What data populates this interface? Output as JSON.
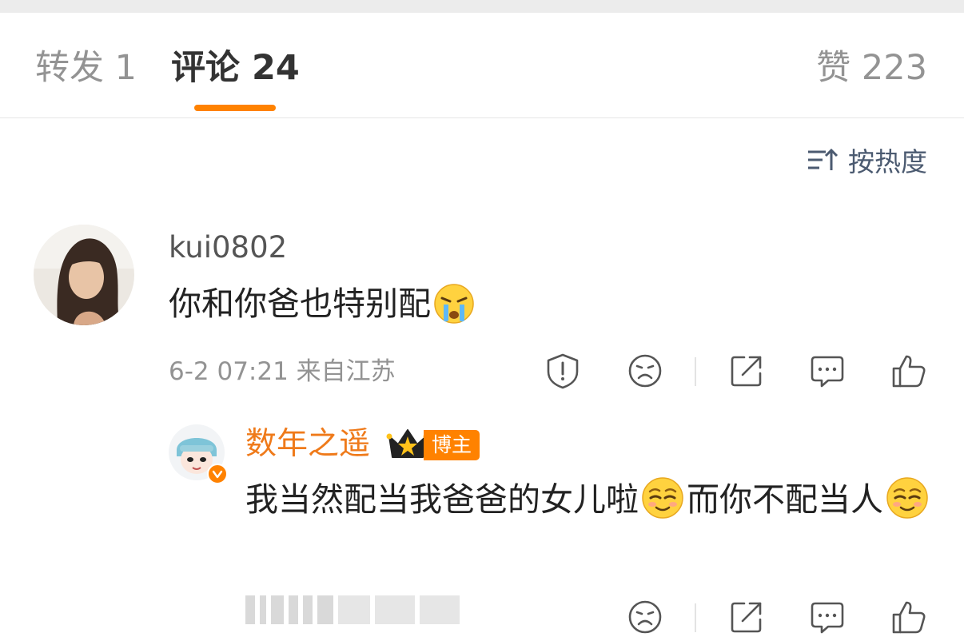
{
  "tabs": {
    "repost": "转发 1",
    "comments": "评论 24",
    "likes": "赞 223"
  },
  "sort": {
    "label": "按热度"
  },
  "comment": {
    "username": "kui0802",
    "text": "你和你爸也特别配",
    "emoji": "crying-emoji",
    "meta": "6-2 07:21 来自江苏"
  },
  "reply": {
    "username": "数年之遥",
    "badge": "博主",
    "text_a": "我当然配当我爸爸的女儿啦",
    "text_b": "而你不配当人",
    "emoji": "smirk-emoji"
  },
  "colors": {
    "accent": "#ff8200",
    "author_name": "#ef7a1a",
    "muted": "#939393",
    "body": "#222222"
  },
  "icons": [
    "report-icon",
    "dislike-icon",
    "share-icon",
    "comment-icon",
    "like-icon",
    "sort-icon",
    "crown-icon",
    "verified-icon"
  ]
}
